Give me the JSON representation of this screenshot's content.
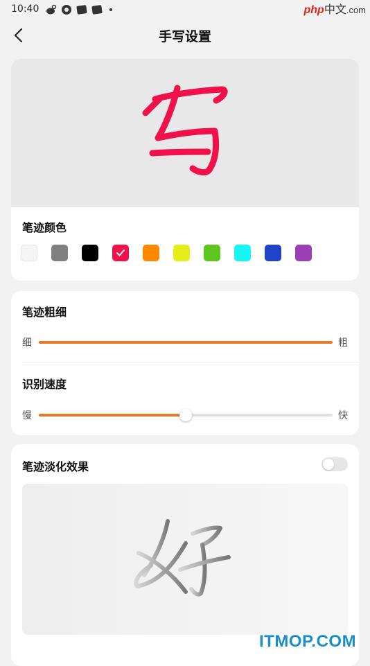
{
  "status_bar": {
    "time": "10:40"
  },
  "watermark": {
    "php": "php",
    "cn": "中文",
    "domain": ".com",
    "bottom": "ITMOP.COM"
  },
  "header": {
    "title": "手写设置"
  },
  "preview": {
    "char": "写",
    "stroke_color": "#f0104a"
  },
  "stroke_color": {
    "label": "笔迹颜色",
    "selected_index": 3,
    "colors": [
      "#f5f5f5",
      "#808080",
      "#000000",
      "#f0104a",
      "#ff8800",
      "#e5ee1a",
      "#5ec41e",
      "#18f5f5",
      "#2044c9",
      "#9b3fb5"
    ]
  },
  "stroke_width": {
    "label": "笔迹粗细",
    "min_label": "细",
    "max_label": "粗",
    "value": 1.0
  },
  "recognition_speed": {
    "label": "识别速度",
    "min_label": "慢",
    "max_label": "快",
    "value": 0.5
  },
  "fade_effect": {
    "label": "笔迹淡化效果",
    "enabled": false,
    "sample_char": "好"
  },
  "colors": {
    "accent": "#e8782a",
    "background": "#f2f2f2",
    "card": "#ffffff"
  }
}
